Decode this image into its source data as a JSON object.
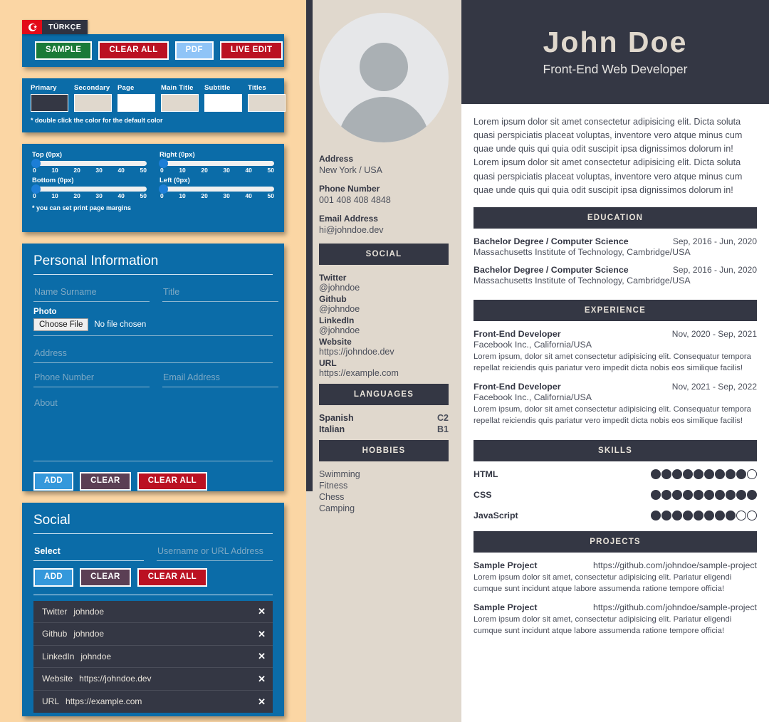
{
  "editor": {
    "language_badge": {
      "label": "TÜRKÇE",
      "flag": "turkish-flag-icon"
    },
    "toolbar": {
      "sample": "SAMPLE",
      "clear_all": "CLEAR ALL",
      "pdf": "PDF",
      "live_edit": "LIVE EDIT"
    },
    "colors": {
      "note": "* double click the color for the default color",
      "items": [
        {
          "label": "Primary",
          "value": "#343744"
        },
        {
          "label": "Secondary",
          "value": "#e0d8cd"
        },
        {
          "label": "Page",
          "value": "#ffffff"
        },
        {
          "label": "Main Title",
          "value": "#e0d8cd"
        },
        {
          "label": "Subtitle",
          "value": "#ffffff"
        },
        {
          "label": "Titles",
          "value": "#e0d8cd"
        }
      ]
    },
    "margins": {
      "note": "* you can set print page margins",
      "ticks": [
        "0",
        "10",
        "20",
        "30",
        "40",
        "50"
      ],
      "sliders": [
        {
          "label": "Top (0px)",
          "value": 0,
          "min": 0,
          "max": 50
        },
        {
          "label": "Right (0px)",
          "value": 0,
          "min": 0,
          "max": 50
        },
        {
          "label": "Bottom (0px)",
          "value": 0,
          "min": 0,
          "max": 50
        },
        {
          "label": "Left (0px)",
          "value": 0,
          "min": 0,
          "max": 50
        }
      ]
    },
    "personal_information": {
      "title": "Personal Information",
      "name_placeholder": "Name Surname",
      "name_value": "",
      "title_placeholder": "Title",
      "title_value": "",
      "photo_label": "Photo",
      "choose_file": "Choose File",
      "file_status": "No file chosen",
      "address_placeholder": "Address",
      "address_value": "",
      "phone_placeholder": "Phone Number",
      "phone_value": "",
      "email_placeholder": "Email Address",
      "email_value": "",
      "about_placeholder": "About",
      "about_value": "",
      "add": "ADD",
      "clear": "CLEAR",
      "clear_all": "CLEAR ALL"
    },
    "social_form": {
      "title": "Social",
      "select_value": "Select",
      "username_placeholder": "Username or URL Address",
      "username_value": "",
      "add": "ADD",
      "clear": "CLEAR",
      "clear_all": "CLEAR ALL",
      "entries": [
        {
          "platform": "Twitter",
          "value": "johndoe",
          "remove": "✕"
        },
        {
          "platform": "Github",
          "value": "johndoe",
          "remove": "✕"
        },
        {
          "platform": "LinkedIn",
          "value": "johndoe",
          "remove": "✕"
        },
        {
          "platform": "Website",
          "value": "https://johndoe.dev",
          "remove": "✕"
        },
        {
          "platform": "URL",
          "value": "https://example.com",
          "remove": "✕"
        }
      ]
    }
  },
  "cv": {
    "header": {
      "name": "John Doe",
      "job_title": "Front-End Web Developer"
    },
    "avatar": "default-person-avatar",
    "contact": [
      {
        "label": "Address",
        "value": "New York / USA"
      },
      {
        "label": "Phone Number",
        "value": "001 408 408 4848"
      },
      {
        "label": "Email Address",
        "value": "hi@johndoe.dev"
      }
    ],
    "social": {
      "heading": "SOCIAL",
      "items": [
        {
          "label": "Twitter",
          "value": "@johndoe"
        },
        {
          "label": "Github",
          "value": "@johndoe"
        },
        {
          "label": "LinkedIn",
          "value": "@johndoe"
        },
        {
          "label": "Website",
          "value": "https://johndoe.dev"
        },
        {
          "label": "URL",
          "value": "https://example.com"
        }
      ]
    },
    "languages": {
      "heading": "LANGUAGES",
      "items": [
        {
          "name": "Spanish",
          "level": "C2"
        },
        {
          "name": "Italian",
          "level": "B1"
        }
      ]
    },
    "hobbies": {
      "heading": "HOBBIES",
      "items": [
        "Swimming",
        "Fitness",
        "Chess",
        "Camping"
      ]
    },
    "summary": "Lorem ipsum dolor sit amet consectetur adipisicing elit. Dicta soluta quasi perspiciatis placeat voluptas, inventore vero atque minus cum quae unde quis qui quia odit suscipit ipsa dignissimos dolorum in! Lorem ipsum dolor sit amet consectetur adipisicing elit. Dicta soluta quasi perspiciatis placeat voluptas, inventore vero atque minus cum quae unde quis qui quia odit suscipit ipsa dignissimos dolorum in!",
    "education": {
      "heading": "EDUCATION",
      "items": [
        {
          "title": "Bachelor Degree / Computer Science",
          "date": "Sep, 2016 - Jun, 2020",
          "sub": "Massachusetts Institute of Technology, Cambridge/USA"
        },
        {
          "title": "Bachelor Degree / Computer Science",
          "date": "Sep, 2016 - Jun, 2020",
          "sub": "Massachusetts Institute of Technology, Cambridge/USA"
        }
      ]
    },
    "experience": {
      "heading": "EXPERIENCE",
      "items": [
        {
          "title": "Front-End Developer",
          "date": "Nov, 2020 - Sep, 2021",
          "sub": "Facebook Inc., California/USA",
          "desc": "Lorem ipsum, dolor sit amet consectetur adipisicing elit. Consequatur tempora repellat reiciendis quis pariatur vero impedit dicta nobis eos similique facilis!"
        },
        {
          "title": "Front-End Developer",
          "date": "Nov, 2021 - Sep, 2022",
          "sub": "Facebook Inc., California/USA",
          "desc": "Lorem ipsum, dolor sit amet consectetur adipisicing elit. Consequatur tempora repellat reiciendis quis pariatur vero impedit dicta nobis eos similique facilis!"
        }
      ]
    },
    "skills": {
      "heading": "SKILLS",
      "max": 10,
      "items": [
        {
          "name": "HTML",
          "level": 9
        },
        {
          "name": "CSS",
          "level": 10
        },
        {
          "name": "JavaScript",
          "level": 8
        }
      ]
    },
    "projects": {
      "heading": "PROJECTS",
      "items": [
        {
          "title": "Sample Project",
          "link": "https://github.com/johndoe/sample-project",
          "desc": "Lorem ipsum dolor sit amet, consectetur adipisicing elit. Pariatur eligendi cumque sunt incidunt atque labore assumenda ratione tempore officia!"
        },
        {
          "title": "Sample Project",
          "link": "https://github.com/johndoe/sample-project",
          "desc": "Lorem ipsum dolor sit amet, consectetur adipisicing elit. Pariatur eligendi cumque sunt incidunt atque labore assumenda ratione tempore officia!"
        }
      ]
    }
  }
}
